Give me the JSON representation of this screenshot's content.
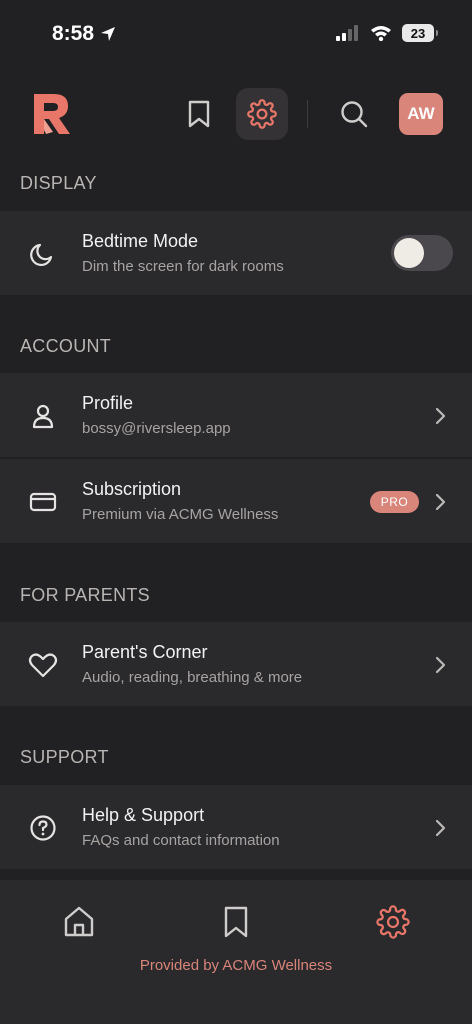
{
  "status_bar": {
    "time": "8:58",
    "battery": "23"
  },
  "header": {
    "avatar_initials": "AW"
  },
  "colors": {
    "accent": "#d9857a",
    "background": "#212023",
    "row": "#2a292c"
  },
  "sections": {
    "display": {
      "title": "DISPLAY",
      "bedtime": {
        "title": "Bedtime Mode",
        "subtitle": "Dim the screen for dark rooms",
        "icon": "moon-icon",
        "enabled": false
      }
    },
    "account": {
      "title": "ACCOUNT",
      "profile": {
        "title": "Profile",
        "subtitle": "bossy@riversleep.app",
        "icon": "user-icon"
      },
      "subscription": {
        "title": "Subscription",
        "subtitle": "Premium via ACMG Wellness",
        "badge": "PRO",
        "icon": "credit-card-icon"
      }
    },
    "parents": {
      "title": "FOR PARENTS",
      "corner": {
        "title": "Parent's Corner",
        "subtitle": "Audio, reading, breathing & more",
        "icon": "heart-icon"
      }
    },
    "support": {
      "title": "SUPPORT",
      "help": {
        "title": "Help & Support",
        "subtitle": "FAQs and contact information",
        "icon": "help-circle-icon"
      }
    }
  },
  "tabbar": {
    "tabs": [
      "home-icon",
      "bookmark-icon",
      "gear-icon"
    ],
    "active": "gear-icon",
    "provided_by": "Provided by ACMG Wellness"
  }
}
